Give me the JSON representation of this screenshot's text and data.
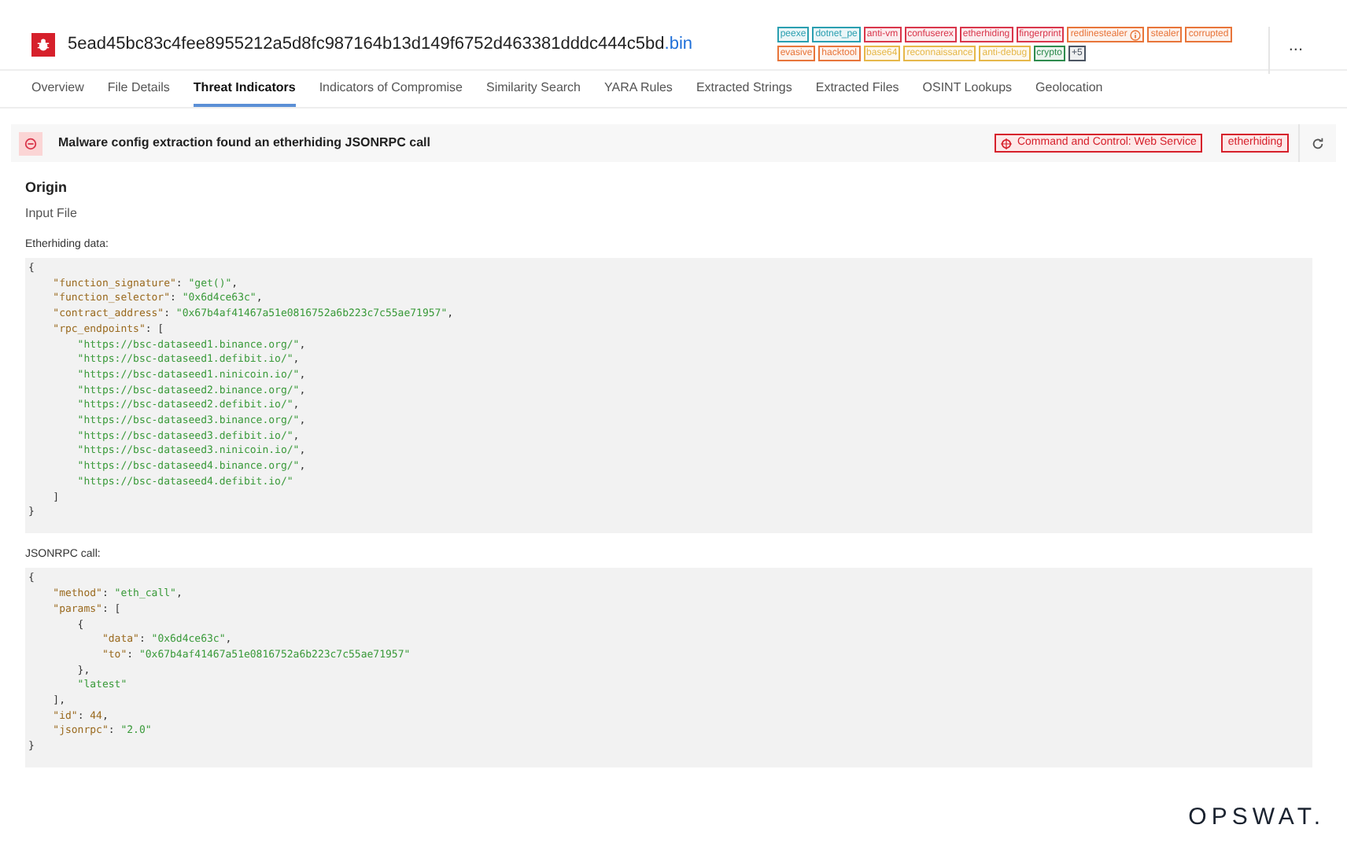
{
  "file": {
    "name": "5ead45bc83c4fee8955212a5d8fc987164b13d149f6752d463381dddc444c5bd",
    "extension": ".bin"
  },
  "tags": [
    {
      "label": "peexe",
      "color": "#2a9fb0",
      "info": false
    },
    {
      "label": "dotnet_pe",
      "color": "#2a9fb0",
      "info": false
    },
    {
      "label": "anti-vm",
      "color": "#d9364b",
      "info": false
    },
    {
      "label": "confuserex",
      "color": "#d9364b",
      "info": false
    },
    {
      "label": "etherhiding",
      "color": "#d9364b",
      "info": false
    },
    {
      "label": "fingerprint",
      "color": "#d9364b",
      "info": false
    },
    {
      "label": "redlinestealer",
      "color": "#e8753a",
      "info": true
    },
    {
      "label": "stealer",
      "color": "#e8753a",
      "info": false
    },
    {
      "label": "corrupted",
      "color": "#e8753a",
      "info": false
    },
    {
      "label": "evasive",
      "color": "#e8753a",
      "info": false
    },
    {
      "label": "hacktool",
      "color": "#e8753a",
      "info": false
    },
    {
      "label": "base64",
      "color": "#e6b84a",
      "info": false
    },
    {
      "label": "reconnaissance",
      "color": "#e6b84a",
      "info": false
    },
    {
      "label": "anti-debug",
      "color": "#e6b84a",
      "info": false
    },
    {
      "label": "crypto",
      "color": "#2e8b4e",
      "info": false
    },
    {
      "label": "+5",
      "color": "#4b5563",
      "info": false
    }
  ],
  "more_button": "...",
  "tabs": [
    {
      "label": "Overview",
      "selected": false
    },
    {
      "label": "File Details",
      "selected": false
    },
    {
      "label": "Threat Indicators",
      "selected": true
    },
    {
      "label": "Indicators of Compromise",
      "selected": false
    },
    {
      "label": "Similarity Search",
      "selected": false
    },
    {
      "label": "YARA Rules",
      "selected": false
    },
    {
      "label": "Extracted Strings",
      "selected": false
    },
    {
      "label": "Extracted Files",
      "selected": false
    },
    {
      "label": "OSINT Lookups",
      "selected": false
    },
    {
      "label": "Geolocation",
      "selected": false
    }
  ],
  "indicator": {
    "title": "Malware config extraction found an etherhiding JSONRPC call",
    "technique": "Command and Control: Web Service",
    "tag": "etherhiding"
  },
  "origin": {
    "heading": "Origin",
    "value": "Input File"
  },
  "sections": [
    {
      "label": "Etherhiding data:",
      "lines": [
        [
          {
            "kind": "punct",
            "text": "{"
          }
        ],
        [
          {
            "kind": "key",
            "text": "    \"function_signature\""
          },
          {
            "kind": "punct",
            "text": ": "
          },
          {
            "kind": "string",
            "text": "\"get()\""
          },
          {
            "kind": "punct",
            "text": ","
          }
        ],
        [
          {
            "kind": "key",
            "text": "    \"function_selector\""
          },
          {
            "kind": "punct",
            "text": ": "
          },
          {
            "kind": "string",
            "text": "\"0x6d4ce63c\""
          },
          {
            "kind": "punct",
            "text": ","
          }
        ],
        [
          {
            "kind": "key",
            "text": "    \"contract_address\""
          },
          {
            "kind": "punct",
            "text": ": "
          },
          {
            "kind": "string",
            "text": "\"0x67b4af41467a51e0816752a6b223c7c55ae71957\""
          },
          {
            "kind": "punct",
            "text": ","
          }
        ],
        [
          {
            "kind": "key",
            "text": "    \"rpc_endpoints\""
          },
          {
            "kind": "punct",
            "text": ": ["
          }
        ],
        [
          {
            "kind": "string",
            "text": "        \"https://bsc-dataseed1.binance.org/\""
          },
          {
            "kind": "punct",
            "text": ","
          }
        ],
        [
          {
            "kind": "string",
            "text": "        \"https://bsc-dataseed1.defibit.io/\""
          },
          {
            "kind": "punct",
            "text": ","
          }
        ],
        [
          {
            "kind": "string",
            "text": "        \"https://bsc-dataseed1.ninicoin.io/\""
          },
          {
            "kind": "punct",
            "text": ","
          }
        ],
        [
          {
            "kind": "string",
            "text": "        \"https://bsc-dataseed2.binance.org/\""
          },
          {
            "kind": "punct",
            "text": ","
          }
        ],
        [
          {
            "kind": "string",
            "text": "        \"https://bsc-dataseed2.defibit.io/\""
          },
          {
            "kind": "punct",
            "text": ","
          }
        ],
        [
          {
            "kind": "string",
            "text": "        \"https://bsc-dataseed3.binance.org/\""
          },
          {
            "kind": "punct",
            "text": ","
          }
        ],
        [
          {
            "kind": "string",
            "text": "        \"https://bsc-dataseed3.defibit.io/\""
          },
          {
            "kind": "punct",
            "text": ","
          }
        ],
        [
          {
            "kind": "string",
            "text": "        \"https://bsc-dataseed3.ninicoin.io/\""
          },
          {
            "kind": "punct",
            "text": ","
          }
        ],
        [
          {
            "kind": "string",
            "text": "        \"https://bsc-dataseed4.binance.org/\""
          },
          {
            "kind": "punct",
            "text": ","
          }
        ],
        [
          {
            "kind": "string",
            "text": "        \"https://bsc-dataseed4.defibit.io/\""
          }
        ],
        [
          {
            "kind": "punct",
            "text": "    ]"
          }
        ],
        [
          {
            "kind": "punct",
            "text": "}"
          }
        ]
      ]
    },
    {
      "label": "JSONRPC call:",
      "lines": [
        [
          {
            "kind": "punct",
            "text": "{"
          }
        ],
        [
          {
            "kind": "key",
            "text": "    \"method\""
          },
          {
            "kind": "punct",
            "text": ": "
          },
          {
            "kind": "string",
            "text": "\"eth_call\""
          },
          {
            "kind": "punct",
            "text": ","
          }
        ],
        [
          {
            "kind": "key",
            "text": "    \"params\""
          },
          {
            "kind": "punct",
            "text": ": ["
          }
        ],
        [
          {
            "kind": "punct",
            "text": "        {"
          }
        ],
        [
          {
            "kind": "key",
            "text": "            \"data\""
          },
          {
            "kind": "punct",
            "text": ": "
          },
          {
            "kind": "string",
            "text": "\"0x6d4ce63c\""
          },
          {
            "kind": "punct",
            "text": ","
          }
        ],
        [
          {
            "kind": "key",
            "text": "            \"to\""
          },
          {
            "kind": "punct",
            "text": ": "
          },
          {
            "kind": "string",
            "text": "\"0x67b4af41467a51e0816752a6b223c7c55ae71957\""
          }
        ],
        [
          {
            "kind": "punct",
            "text": "        },"
          }
        ],
        [
          {
            "kind": "string",
            "text": "        \"latest\""
          }
        ],
        [
          {
            "kind": "punct",
            "text": "    ],"
          }
        ],
        [
          {
            "kind": "key",
            "text": "    \"id\""
          },
          {
            "kind": "punct",
            "text": ": "
          },
          {
            "kind": "number",
            "text": "44"
          },
          {
            "kind": "punct",
            "text": ","
          }
        ],
        [
          {
            "kind": "key",
            "text": "    \"jsonrpc\""
          },
          {
            "kind": "punct",
            "text": ": "
          },
          {
            "kind": "string",
            "text": "\"2.0\""
          }
        ],
        [
          {
            "kind": "punct",
            "text": "}"
          }
        ]
      ]
    }
  ],
  "logo": "OPSWAT."
}
